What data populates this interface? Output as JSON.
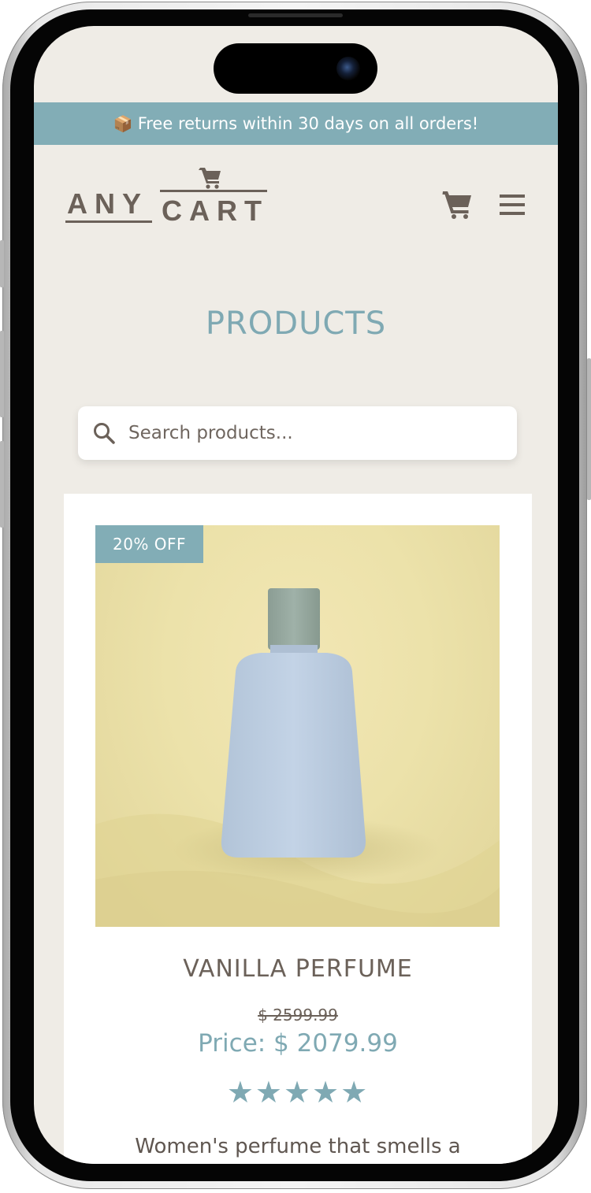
{
  "announcement": {
    "icon": "package-icon",
    "text": "Free returns within 30 days on all orders!"
  },
  "header": {
    "logo": {
      "text_left": "ANY",
      "text_right": "CART"
    },
    "cart_icon": "cart-icon",
    "menu_icon": "hamburger-menu-icon"
  },
  "page": {
    "title": "PRODUCTS"
  },
  "search": {
    "placeholder": "Search products..."
  },
  "product": {
    "badge": "20% OFF",
    "name": "VANILLA PERFUME",
    "old_price": "$ 2599.99",
    "price": "Price: $ 2079.99",
    "rating": 5,
    "rating_max": 5,
    "rating_stars": "★★★★★",
    "description": "Women's perfume that smells a"
  },
  "colors": {
    "accent": "#82adb6",
    "background": "#efece6",
    "text_brown": "#6b6159"
  }
}
